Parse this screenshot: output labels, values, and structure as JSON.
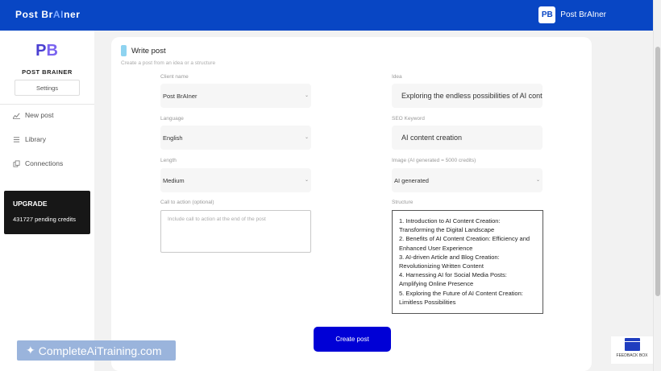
{
  "header": {
    "brand_pre": "Post Br",
    "brand_ai": "AI",
    "brand_post": "ner",
    "logo_text": "PB",
    "app_name": "Post BrAIner"
  },
  "sidebar": {
    "logo_p": "P",
    "logo_b": "B",
    "title": "POST BRAINER",
    "settings_label": "Settings",
    "items": [
      {
        "label": "New post",
        "icon": "chart-icon"
      },
      {
        "label": "Library",
        "icon": "list-icon"
      },
      {
        "label": "Connections",
        "icon": "copy-icon"
      }
    ],
    "upgrade": {
      "title": "UPGRADE",
      "credits": "431727 pending credits"
    }
  },
  "form": {
    "title": "Write post",
    "subtitle": "Create a post from an idea or a structure",
    "client_name": {
      "label": "Client name",
      "value": "Post BrAIner"
    },
    "idea": {
      "label": "Idea",
      "value": "Exploring the endless possibilities of AI content creation"
    },
    "language": {
      "label": "Language",
      "value": "English"
    },
    "seo_keyword": {
      "label": "SEO Keyword",
      "value": "AI content creation"
    },
    "length": {
      "label": "Length",
      "value": "Medium"
    },
    "image": {
      "label": "Image (AI generated = 5000 credits)",
      "value": "AI generated"
    },
    "cta": {
      "label": "Call to action (optional)",
      "placeholder": "Include call to action at the end of the post"
    },
    "structure": {
      "label": "Structure",
      "text": "1. Introduction to AI Content Creation: Transforming the Digital Landscape\n2. Benefits of AI Content Creation: Efficiency and Enhanced User Experience\n3. AI-driven Article and Blog Creation: Revolutionizing Written Content\n4. Harnessing AI for Social Media Posts: Amplifying Online Presence\n5. Exploring the Future of AI Content Creation: Limitless Possibilities"
    },
    "submit_label": "Create post"
  },
  "watermark": {
    "text": "CompleteAiTraining.com"
  },
  "feedback": {
    "label": "FEEDBACK BOX"
  },
  "colors": {
    "header_bg": "#0846c4",
    "primary_button": "#0000d6",
    "upgrade_bg": "#171717",
    "accent": "#8ed3f0"
  }
}
